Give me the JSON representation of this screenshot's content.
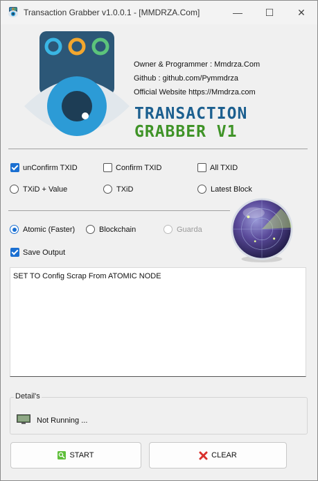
{
  "window": {
    "title": "Transaction Grabber v1.0.0.1 - [MMDRZA.Com]",
    "minimize_glyph": "—",
    "maximize_glyph": "☐",
    "close_glyph": "✕"
  },
  "header": {
    "owner_line": "Owner & Programmer : Mmdrza.Com",
    "github_line": "Github : github.com/Pymmdrza",
    "website_line": "Official Website https://Mmdrza.com",
    "brand_line1": "TRANSACTION",
    "brand_line2": "GRABBER V1",
    "brand_colors": {
      "line1": "#1c5f8f",
      "line2": "#3f9327"
    }
  },
  "tx_options": {
    "unconfirm_txid": {
      "label": "unConfirm TXID",
      "checked": true
    },
    "confirm_txid": {
      "label": "Confirm TXID",
      "checked": false
    },
    "all_txid": {
      "label": "All TXID",
      "checked": false
    },
    "txid_value": {
      "label": "TXiD + Value",
      "selected": false
    },
    "txid": {
      "label": "TXiD",
      "selected": false
    },
    "latest_block": {
      "label": "Latest Block",
      "selected": false
    }
  },
  "source_options": {
    "atomic": {
      "label": "Atomic (Faster)",
      "selected": true
    },
    "blockchain": {
      "label": "Blockchain",
      "selected": false
    },
    "guarda": {
      "label": "Guarda",
      "selected": false,
      "disabled": true
    },
    "save_output": {
      "label": "Save Output",
      "checked": true
    }
  },
  "output": {
    "text": "SET TO Config Scrap From ATOMIC NODE"
  },
  "details": {
    "legend": "Detail's",
    "status_text": "Not Running ..."
  },
  "buttons": {
    "start_label": "START",
    "clear_label": "CLEAR"
  },
  "icons": {
    "app": "eye-logo-icon",
    "radar": "radar-globe-icon",
    "status": "monitor-icon",
    "start": "search-icon",
    "clear": "red-x-icon"
  },
  "accent_color": "#1a6fd1"
}
